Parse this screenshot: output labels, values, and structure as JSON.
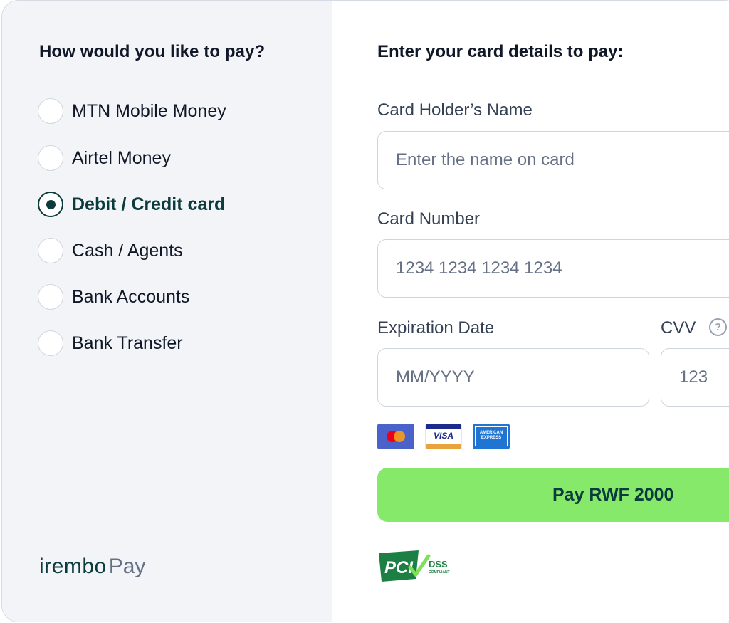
{
  "left": {
    "title": "How would you like to pay?",
    "options": [
      {
        "label": "MTN Mobile Money",
        "selected": false
      },
      {
        "label": "Airtel Money",
        "selected": false
      },
      {
        "label": "Debit / Credit card",
        "selected": true
      },
      {
        "label": "Cash / Agents",
        "selected": false
      },
      {
        "label": "Bank Accounts",
        "selected": false
      },
      {
        "label": "Bank Transfer",
        "selected": false
      }
    ],
    "brand": {
      "irembo": "irembo",
      "pay": "Pay"
    }
  },
  "right": {
    "title": "Enter your card details to pay:",
    "card_holder": {
      "label": "Card Holder’s Name",
      "placeholder": "Enter the name on card",
      "value": ""
    },
    "card_number": {
      "label": "Card Number",
      "placeholder": "1234 1234 1234 1234",
      "value": ""
    },
    "expiration": {
      "label": "Expiration Date",
      "placeholder": "MM/YYYY",
      "value": ""
    },
    "cvv": {
      "label": "CVV",
      "placeholder": "123",
      "value": "",
      "help_icon": "question-circle-icon"
    },
    "card_brands": {
      "mastercard": "mastercard-logo",
      "visa": "VISA",
      "amex_line1": "AMERICAN",
      "amex_line2": "EXPRESS"
    },
    "pay_button": "Pay RWF 2000",
    "pci": {
      "mark": "PCI",
      "dss": "DSS",
      "compliant": "COMPLIANT"
    }
  },
  "colors": {
    "accent_dark": "#0b3b3c",
    "pay_button": "#86e96a",
    "left_panel_bg": "#f2f4f7",
    "pci_green": "#1c7f43"
  }
}
